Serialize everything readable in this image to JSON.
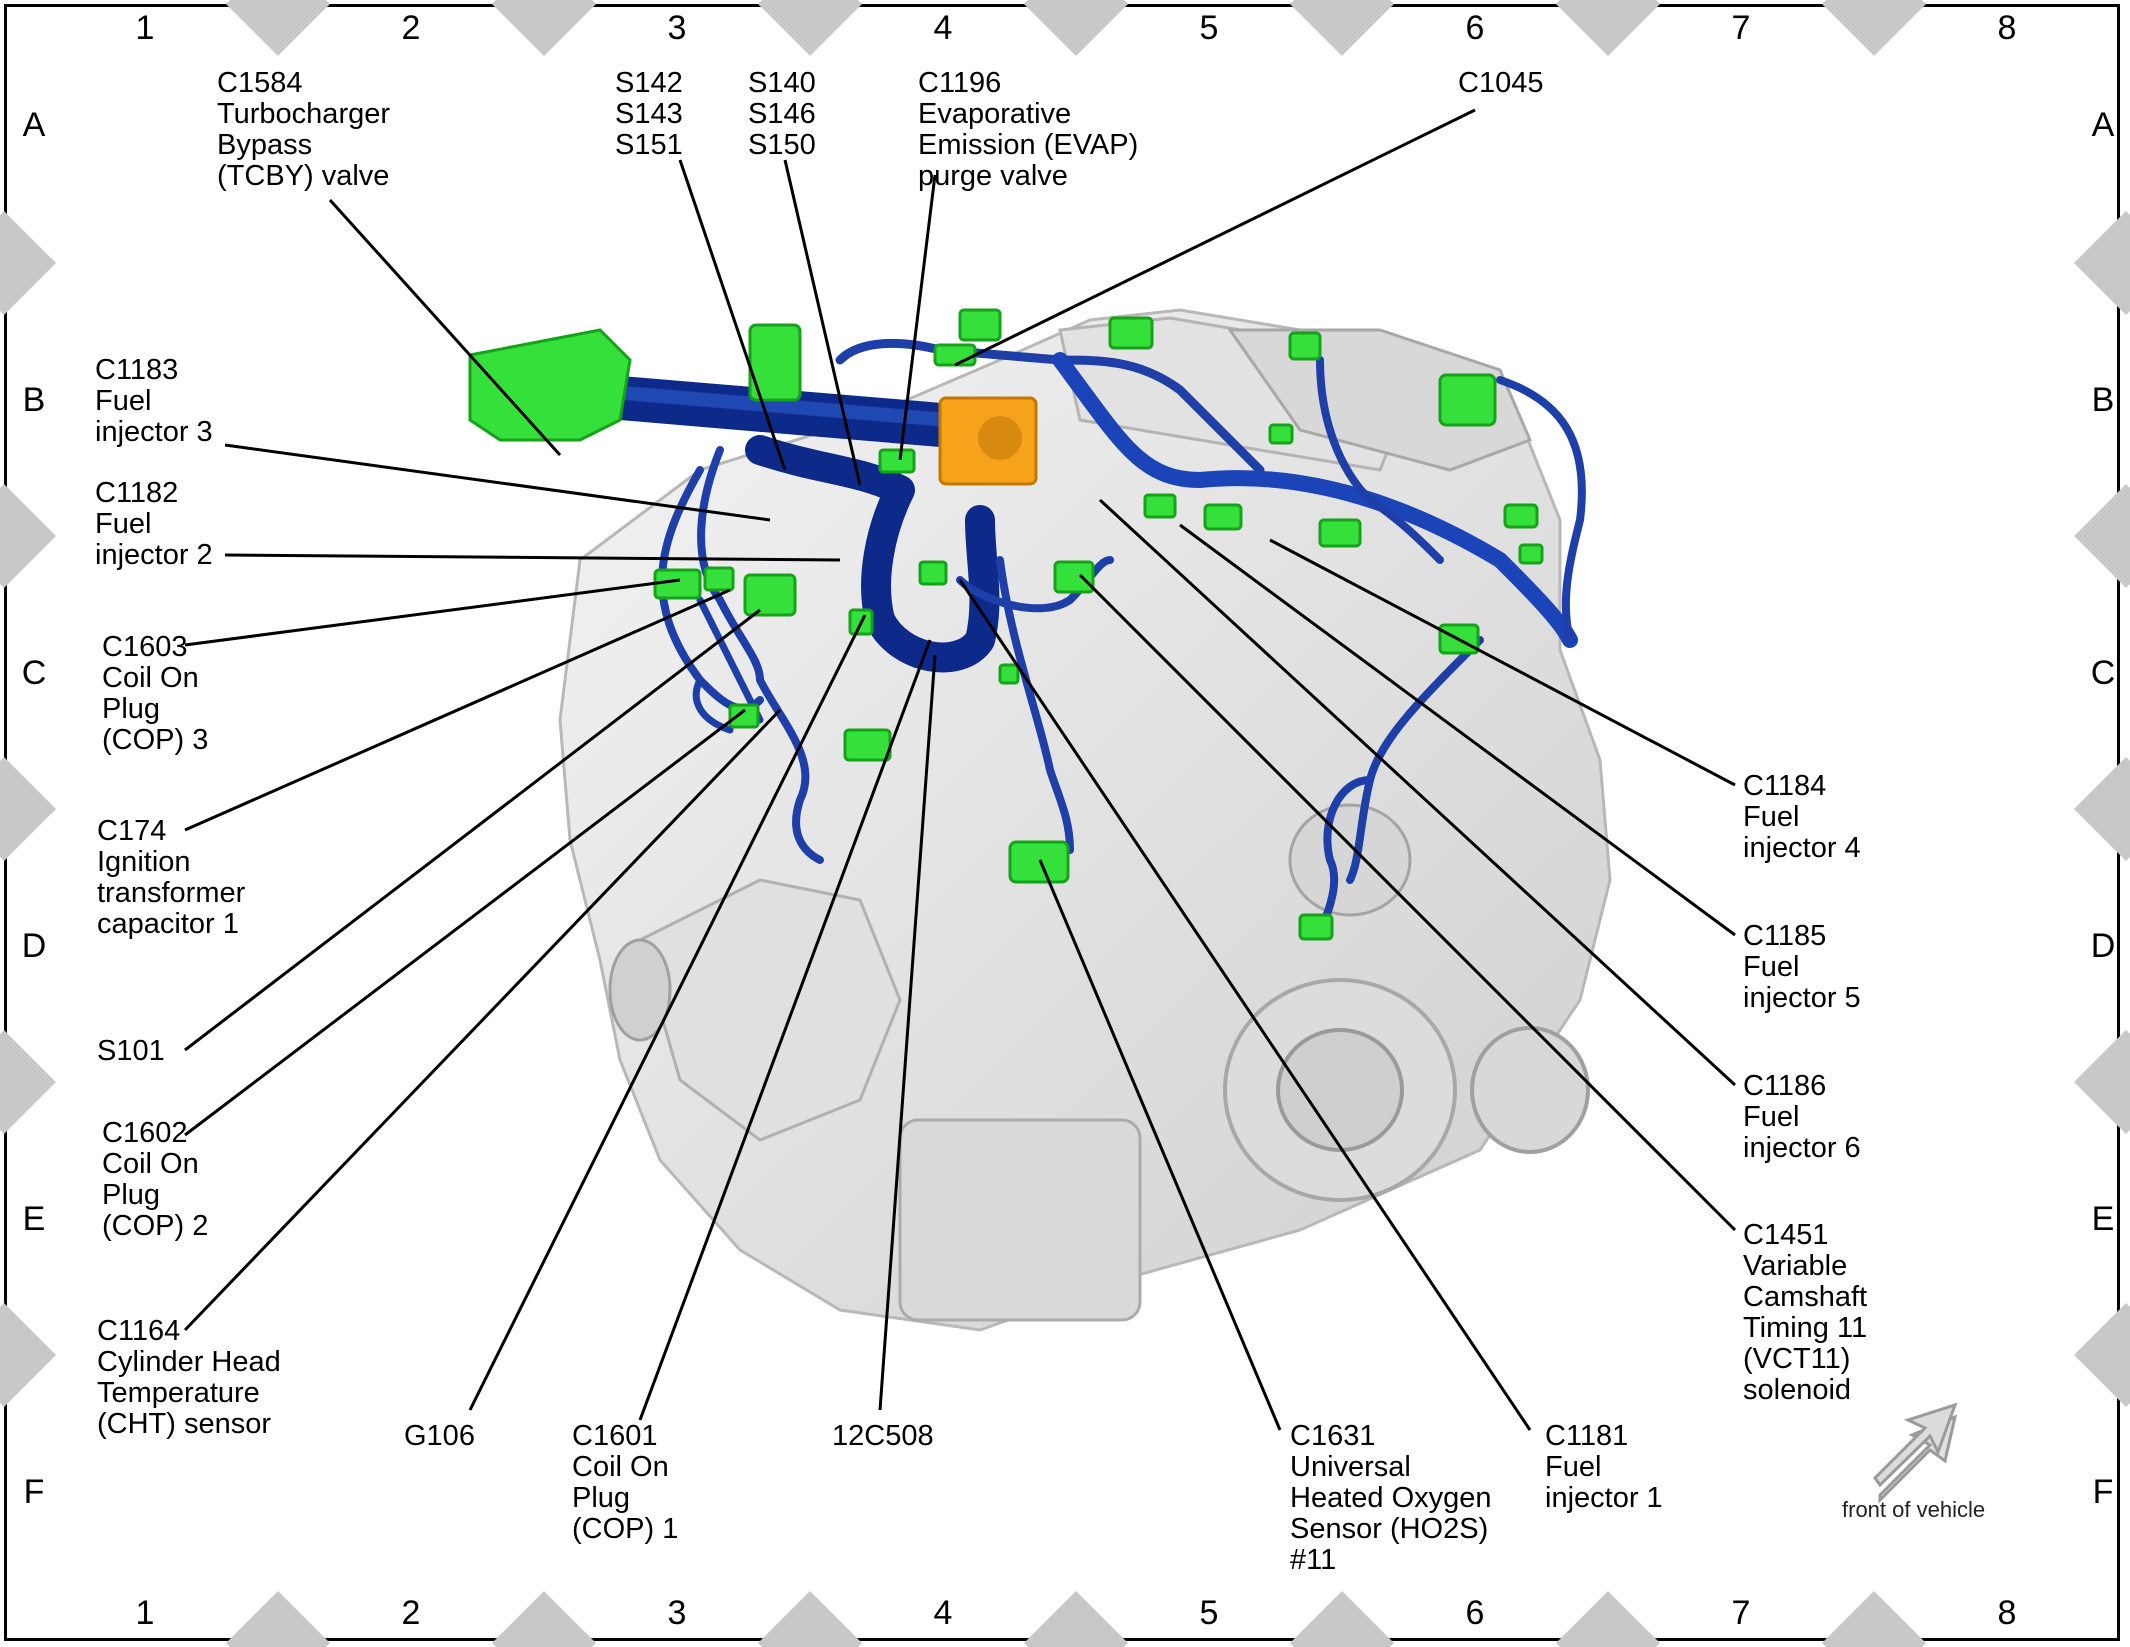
{
  "grid": {
    "columns": [
      "1",
      "2",
      "3",
      "4",
      "5",
      "6",
      "7",
      "8"
    ],
    "rows": [
      "A",
      "B",
      "C",
      "D",
      "E",
      "F"
    ]
  },
  "orientation_label": "front of vehicle",
  "callouts": [
    {
      "id": "c1584",
      "lines": [
        "C1584",
        "Turbocharger",
        "Bypass",
        "(TCBY) valve"
      ]
    },
    {
      "id": "s142",
      "lines": [
        "S142",
        "S143",
        "S151"
      ]
    },
    {
      "id": "s140",
      "lines": [
        "S140",
        "S146",
        "S150"
      ]
    },
    {
      "id": "c1196",
      "lines": [
        "C1196",
        "Evaporative",
        "Emission (EVAP)",
        "purge valve"
      ]
    },
    {
      "id": "c1045",
      "lines": [
        "C1045"
      ]
    },
    {
      "id": "c1183",
      "lines": [
        "C1183",
        "Fuel",
        "injector 3"
      ]
    },
    {
      "id": "c1182",
      "lines": [
        "C1182",
        "Fuel",
        "injector 2"
      ]
    },
    {
      "id": "c1603",
      "lines": [
        "C1603",
        "Coil On",
        "Plug",
        "(COP) 3"
      ]
    },
    {
      "id": "c174",
      "lines": [
        "C174",
        "Ignition",
        "transformer",
        "capacitor 1"
      ]
    },
    {
      "id": "s101",
      "lines": [
        "S101"
      ]
    },
    {
      "id": "c1602",
      "lines": [
        "C1602",
        "Coil On",
        "Plug",
        "(COP) 2"
      ]
    },
    {
      "id": "c1164",
      "lines": [
        "C1164",
        "Cylinder Head",
        "Temperature",
        "(CHT) sensor"
      ]
    },
    {
      "id": "g106",
      "lines": [
        "G106"
      ]
    },
    {
      "id": "c1601",
      "lines": [
        "C1601",
        "Coil On",
        "Plug",
        "(COP) 1"
      ]
    },
    {
      "id": "12c508",
      "lines": [
        "12C508"
      ]
    },
    {
      "id": "c1631",
      "lines": [
        "C1631",
        "Universal",
        "Heated Oxygen",
        "Sensor (HO2S)",
        "#11"
      ]
    },
    {
      "id": "c1181",
      "lines": [
        "C1181",
        "Fuel",
        "injector 1"
      ]
    },
    {
      "id": "c1184",
      "lines": [
        "C1184",
        "Fuel",
        "injector 4"
      ]
    },
    {
      "id": "c1185",
      "lines": [
        "C1185",
        "Fuel",
        "injector 5"
      ]
    },
    {
      "id": "c1186",
      "lines": [
        "C1186",
        "Fuel",
        "injector 6"
      ]
    },
    {
      "id": "c1451",
      "lines": [
        "C1451",
        "Variable",
        "Camshaft",
        "Timing 11",
        "(VCT11)",
        "solenoid"
      ]
    }
  ],
  "colors": {
    "harness": "#1f3fa8",
    "harness_dark": "#0d2a8a",
    "connector": "#35e03a",
    "connector_dark": "#16a21b",
    "component_orange": "#f6a21a",
    "engine": "#e6e6e6",
    "marker": "#c8c8c8"
  }
}
